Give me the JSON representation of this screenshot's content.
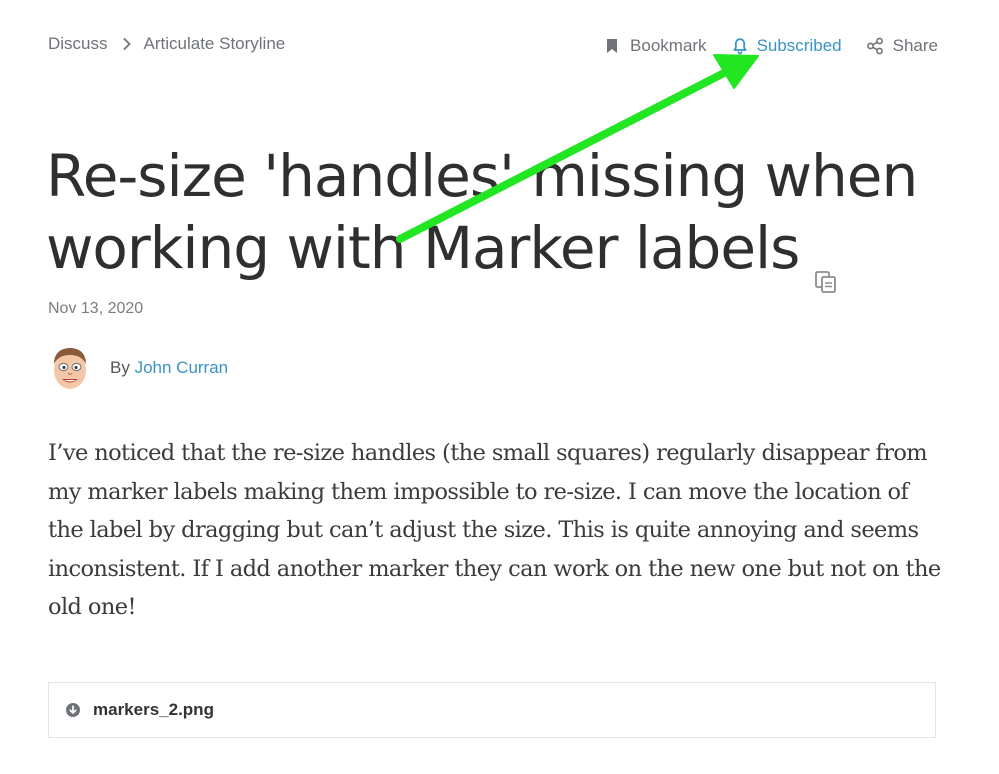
{
  "breadcrumb": {
    "items": [
      "Discuss",
      "Articulate Storyline"
    ]
  },
  "actions": {
    "bookmark_label": "Bookmark",
    "subscribed_label": "Subscribed",
    "share_label": "Share"
  },
  "post": {
    "title": "Re-size 'handles' missing when working with Marker labels",
    "date": "Nov 13, 2020",
    "author_prefix": "By",
    "author_name": "John Curran",
    "body": "I’ve noticed that the re-size handles (the small squares) regularly disappear from my marker labels making them impossible to re-size. I can move the location of the label by dragging but can’t adjust the size. This is quite annoying and seems inconsistent. If I add another marker they can work on the new one but not on the old one!"
  },
  "attachment": {
    "filename": "markers_2.png"
  },
  "icons": {
    "breadcrumb_separator": "chevron-right-icon",
    "bookmark": "bookmark-icon",
    "subscribed": "bell-icon",
    "share": "share-icon",
    "title_copy": "copy-icon",
    "attachment_download": "download-icon"
  },
  "colors": {
    "link": "#3a93c4",
    "muted": "#6f7378",
    "annotation_arrow": "#22e622"
  }
}
